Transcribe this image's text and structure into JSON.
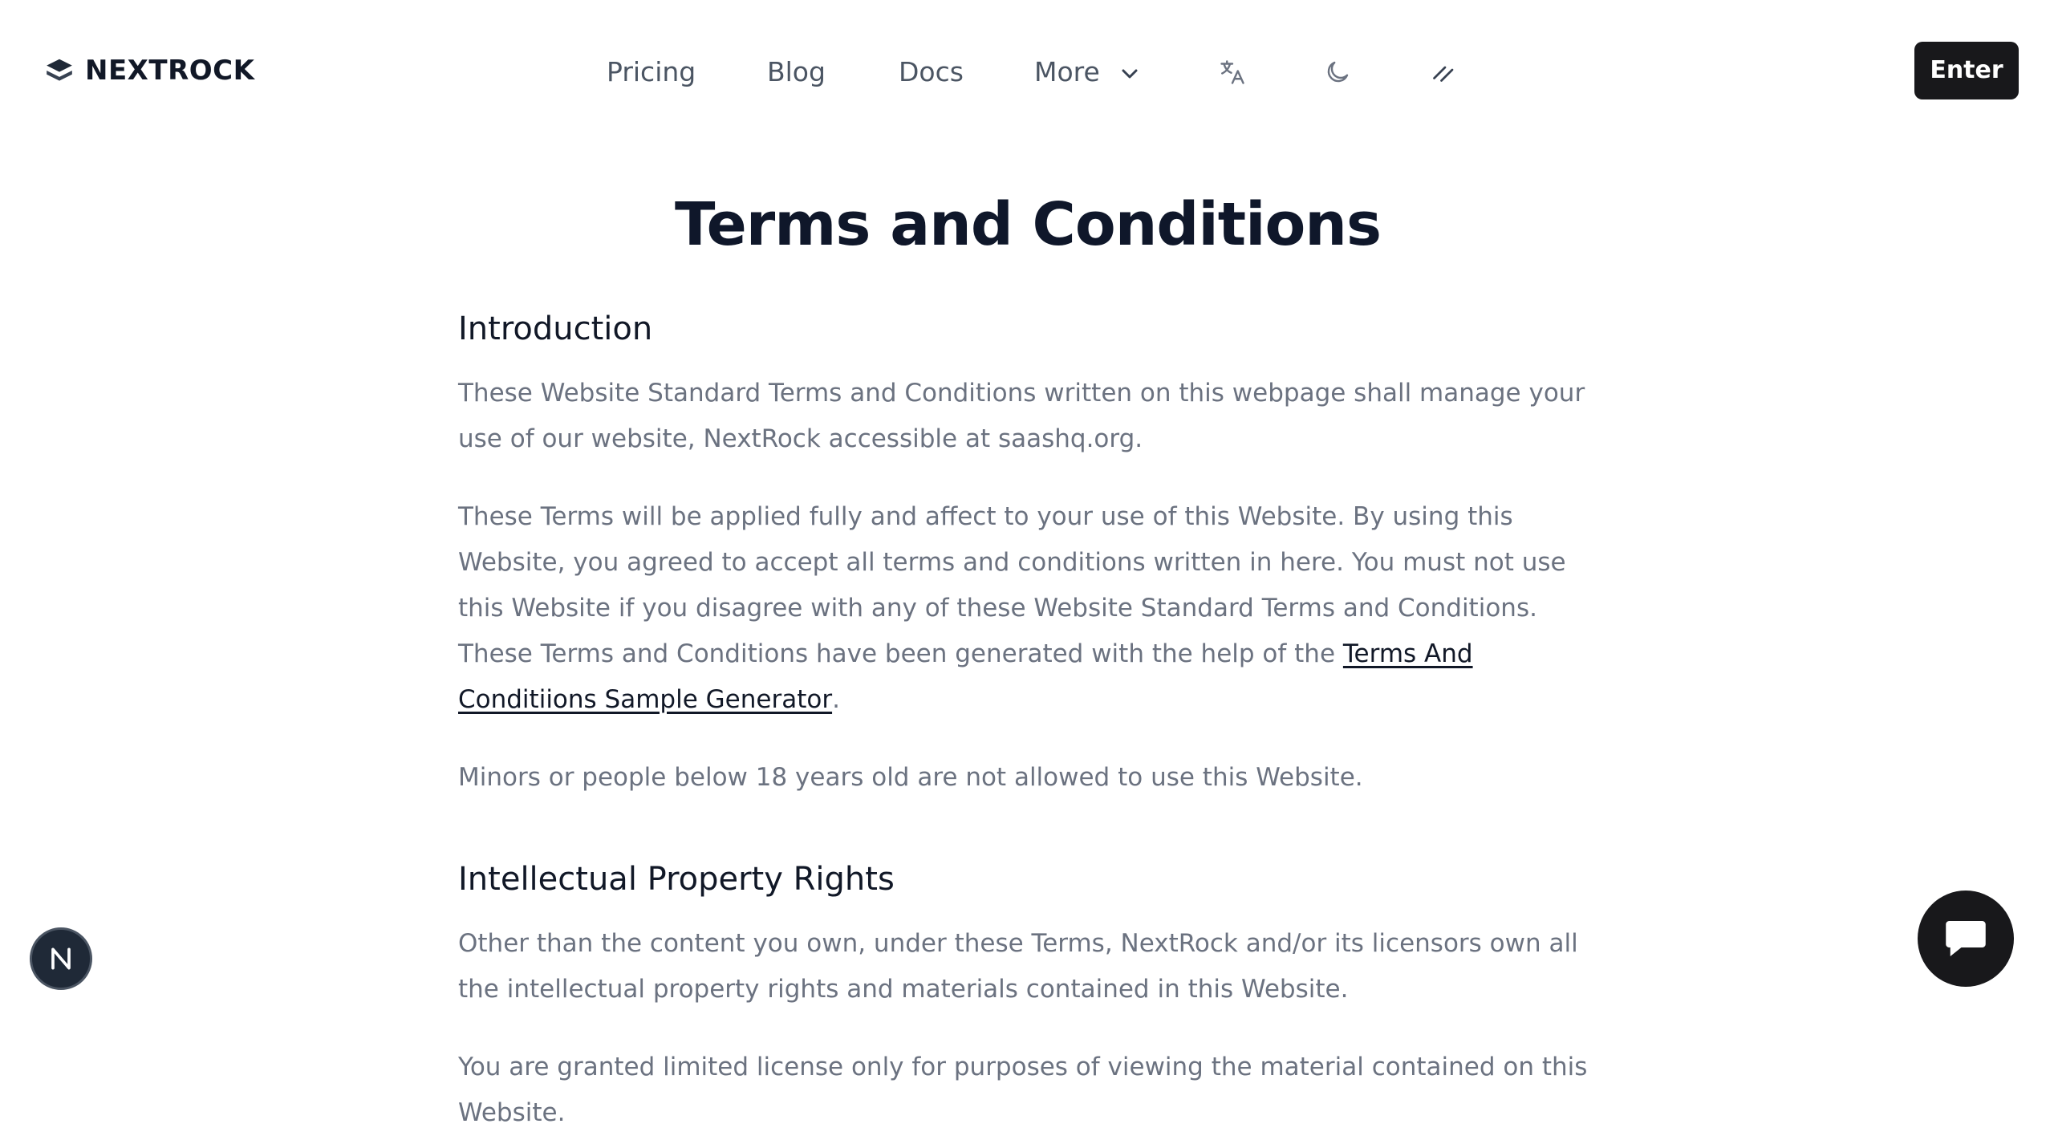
{
  "brand": {
    "name": "NEXTROCK"
  },
  "nav": {
    "items": [
      "Pricing",
      "Blog",
      "Docs",
      "More"
    ],
    "icons": [
      "translate-icon",
      "moon-icon",
      "slash-icon"
    ],
    "enter_label": "Enter"
  },
  "page": {
    "title": "Terms and Conditions",
    "sections": [
      {
        "heading": "Introduction",
        "p1": "These Website Standard Terms and Conditions written on this webpage shall manage your use of our website, NextRock accessible at saashq.org.",
        "p2_before": "These Terms will be applied fully and affect to your use of this Website. By using this Website, you agreed to accept all terms and conditions written in here. You must not use this Website if you disagree with any of these Website Standard Terms and Conditions. These Terms and Conditions have been generated with the help of the ",
        "p2_link": "Terms And Conditiions Sample Generator",
        "p2_after": ".",
        "p3": "Minors or people below 18 years old are not allowed to use this Website."
      },
      {
        "heading": "Intellectual Property Rights",
        "p1": "Other than the content you own, under these Terms, NextRock and/or its licensors own all the intellectual property rights and materials contained in this Website.",
        "p2": "You are granted limited license only for purposes of viewing the material contained on this Website."
      }
    ]
  },
  "floating": {
    "badge_letter": "N",
    "chat": "chat-icon"
  },
  "colors": {
    "text_primary": "#0f172a",
    "text_muted": "#6b7280",
    "button_dark": "#18181b"
  }
}
